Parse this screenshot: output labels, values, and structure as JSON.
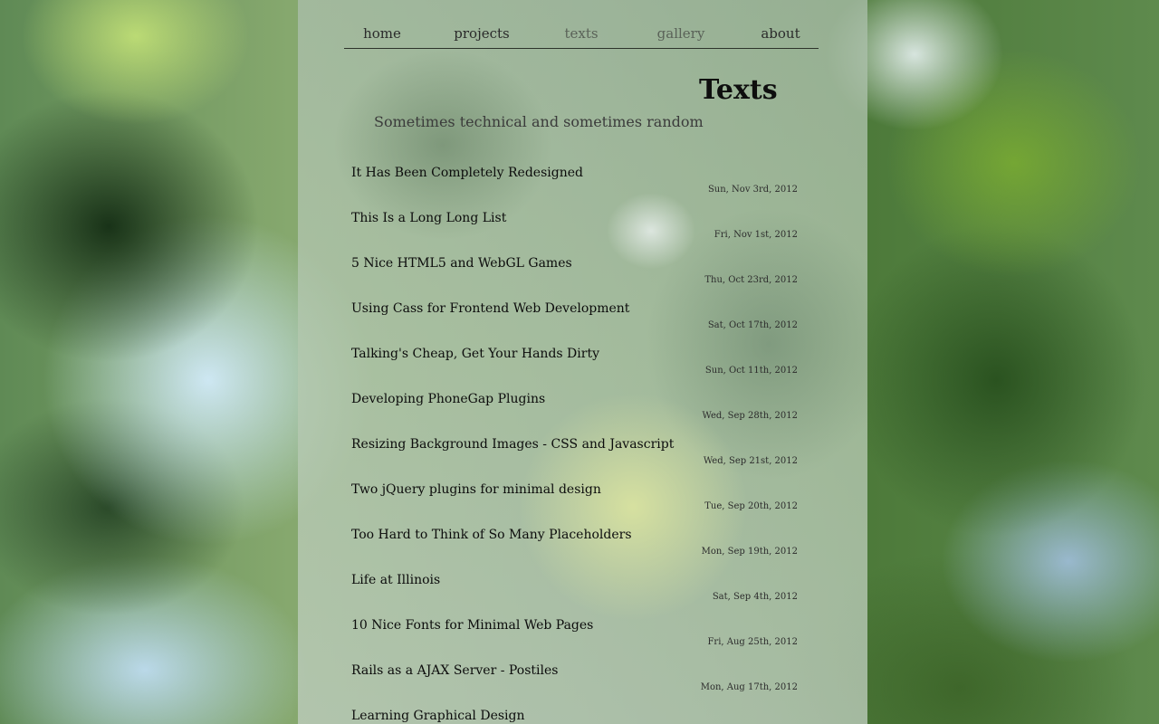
{
  "nav": {
    "items": [
      {
        "label": "home"
      },
      {
        "label": "projects"
      },
      {
        "label": "texts"
      },
      {
        "label": "gallery"
      },
      {
        "label": "about"
      }
    ]
  },
  "header": {
    "title": "Texts",
    "subtitle": "Sometimes technical and sometimes random"
  },
  "posts": [
    {
      "title": "It Has Been Completely Redesigned",
      "date": "Sun, Nov 3rd, 2012"
    },
    {
      "title": "This Is a Long Long List",
      "date": "Fri, Nov 1st, 2012"
    },
    {
      "title": "5 Nice HTML5 and WebGL Games",
      "date": "Thu, Oct 23rd, 2012"
    },
    {
      "title": "Using Cass for Frontend Web Development",
      "date": "Sat, Oct 17th, 2012"
    },
    {
      "title": "Talking's Cheap, Get Your Hands Dirty",
      "date": "Sun, Oct 11th, 2012"
    },
    {
      "title": "Developing PhoneGap Plugins",
      "date": "Wed, Sep 28th, 2012"
    },
    {
      "title": "Resizing Background Images - CSS and Javascript",
      "date": "Wed, Sep 21st, 2012"
    },
    {
      "title": "Two jQuery plugins for minimal design",
      "date": "Tue, Sep 20th, 2012"
    },
    {
      "title": "Too Hard to Think of So Many Placeholders",
      "date": "Mon, Sep 19th, 2012"
    },
    {
      "title": "Life at Illinois",
      "date": "Sat, Sep 4th, 2012"
    },
    {
      "title": "10 Nice Fonts for Minimal Web Pages",
      "date": "Fri, Aug 25th, 2012"
    },
    {
      "title": "Rails as a AJAX Server - Postiles",
      "date": "Mon, Aug 17th, 2012"
    },
    {
      "title": "Learning Graphical Design",
      "date": ""
    }
  ]
}
